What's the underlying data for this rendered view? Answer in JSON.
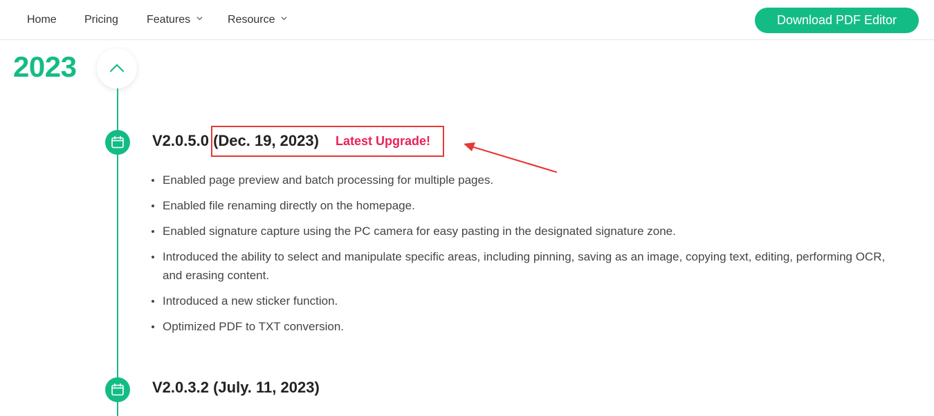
{
  "nav": {
    "items": [
      {
        "label": "Home"
      },
      {
        "label": "Pricing"
      },
      {
        "label": "Features"
      },
      {
        "label": "Resource"
      }
    ],
    "download_label": "Download PDF Editor"
  },
  "timeline": {
    "year": "2023",
    "releases": [
      {
        "version": "V2.0.5.0",
        "date": "(Dec. 19, 2023)",
        "badge": "Latest Upgrade!",
        "changes": [
          "Enabled page preview and batch processing for multiple pages.",
          "Enabled file renaming directly on the homepage.",
          "Enabled signature capture using the PC camera for easy pasting in the designated signature zone.",
          "Introduced the ability to select and manipulate specific areas, including pinning, saving as an image, copying text, editing, performing OCR, and erasing content.",
          "Introduced a new sticker function.",
          "Optimized PDF to TXT conversion."
        ]
      },
      {
        "version": "V2.0.3.2",
        "date": "(July. 11, 2023)"
      }
    ]
  },
  "colors": {
    "brand_green": "#14bc85",
    "badge_pink": "#e8225a",
    "annotation_red": "#e53935"
  },
  "icons": {
    "dropdown": "chevron-down-icon",
    "collapse": "chevron-up-icon",
    "release": "calendar-icon",
    "annotation": "arrow-icon"
  }
}
